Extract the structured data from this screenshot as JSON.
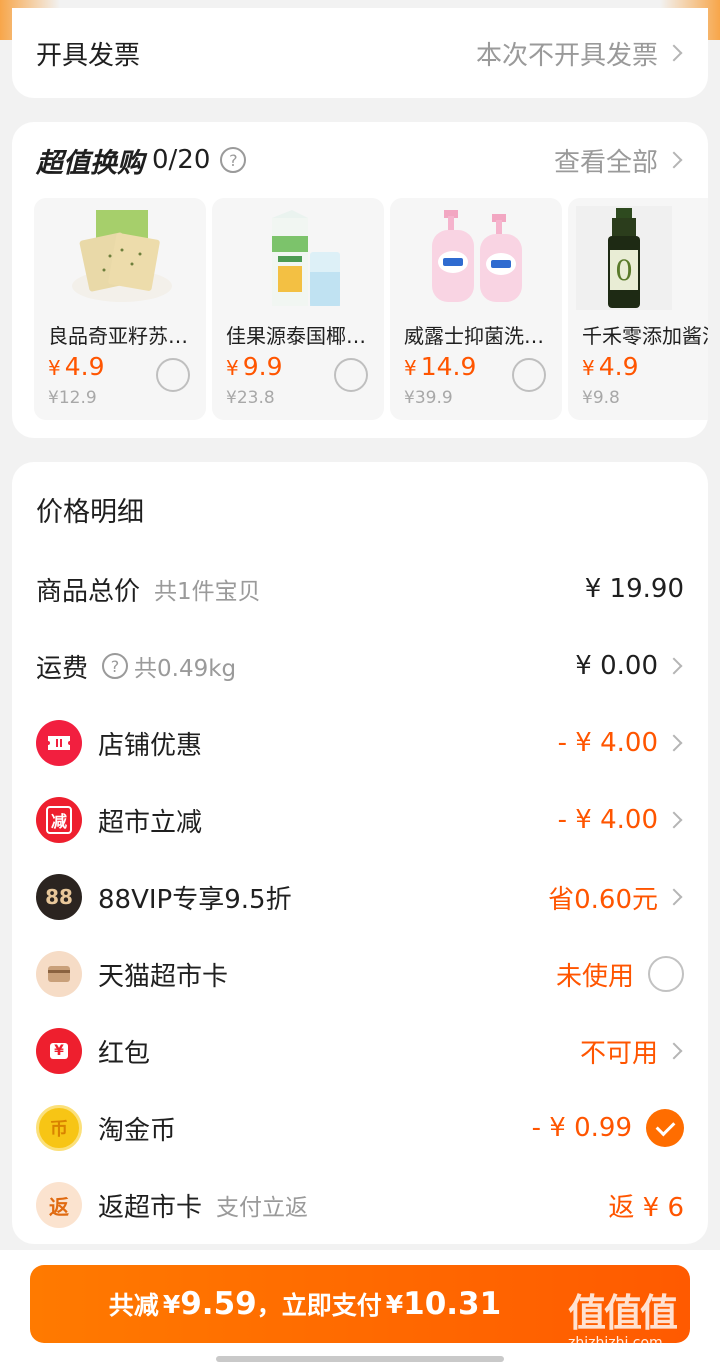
{
  "invoice": {
    "label": "开具发票",
    "value": "本次不开具发票"
  },
  "swap": {
    "title": "超值换购",
    "count": "0/20",
    "help_icon": "question-circle-icon",
    "view_all": "查看全部",
    "products": [
      {
        "name": "良品奇亚籽苏打饼干",
        "currency": "¥",
        "price": "4.9",
        "original": "¥12.9",
        "image": "cracker-pack-image"
      },
      {
        "name": "佳果源泰国椰子水",
        "currency": "¥",
        "price": "9.9",
        "original": "¥23.8",
        "image": "coconut-water-carton-image"
      },
      {
        "name": "威露士抑菌洗手液",
        "currency": "¥",
        "price": "14.9",
        "original": "¥39.9",
        "image": "hand-soap-bottles-image"
      },
      {
        "name": "千禾零添加酱油",
        "currency": "¥",
        "price": "4.9",
        "original": "¥9.8",
        "image": "soy-sauce-bottle-image"
      }
    ]
  },
  "price_detail": {
    "title": "价格明细",
    "rows": [
      {
        "label": "商品总价",
        "sub": "共1件宝贝",
        "value": "¥ 19.90"
      },
      {
        "label": "运费",
        "sub": "共0.49kg",
        "value": "¥ 0.00"
      },
      {
        "label": "店铺优惠",
        "value": "- ¥ 4.00",
        "icon": "shop-coupon-icon"
      },
      {
        "label": "超市立减",
        "value": "- ¥ 4.00",
        "icon": "instant-discount-icon",
        "icon_text": "减"
      },
      {
        "label": "88VIP专享9.5折",
        "value": "省0.60元",
        "icon": "88vip-icon",
        "icon_text": "88"
      },
      {
        "label": "天猫超市卡",
        "value": "未使用",
        "icon": "tmall-card-icon"
      },
      {
        "label": "红包",
        "value": "不可用",
        "icon": "red-packet-icon",
        "icon_text": "¥"
      },
      {
        "label": "淘金币",
        "value": "- ¥ 0.99",
        "icon": "taojinbi-coin-icon",
        "icon_text": "币"
      },
      {
        "label": "返超市卡",
        "sub": "支付立返",
        "value": "返 ¥ 6",
        "icon": "rebate-icon",
        "icon_text": "返"
      }
    ]
  },
  "pay": {
    "prefix": "共减",
    "saved_cur": "¥",
    "saved": "9.59",
    "middle": "，立即支付",
    "pay_cur": "¥",
    "amount": "10.31"
  },
  "watermark": {
    "main": "值值值",
    "sub": "zhizhizhi.com"
  },
  "colors": {
    "accent": "#ff5500",
    "button": "#ff6a00",
    "muted": "#9a9a9a"
  }
}
